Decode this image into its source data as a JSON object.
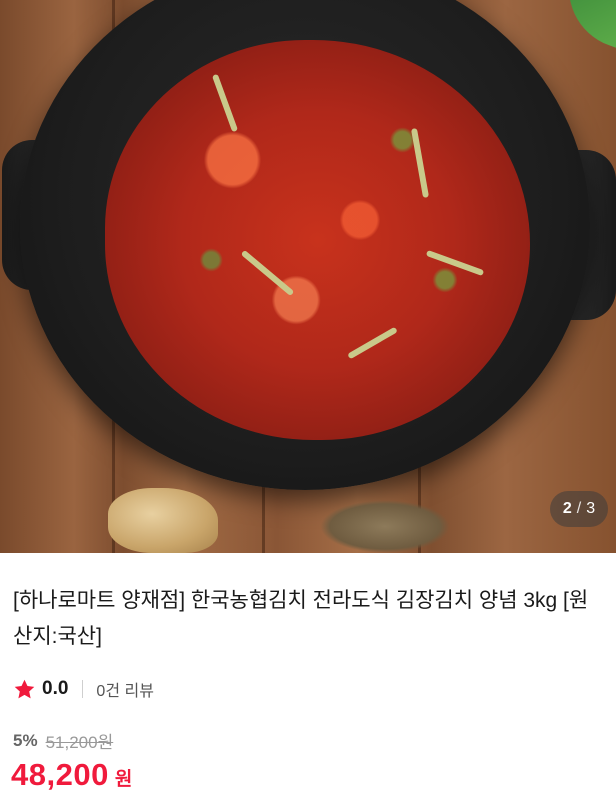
{
  "gallery": {
    "current": "2",
    "separator": "/",
    "total": "3"
  },
  "product": {
    "title": "[하나로마트 양재점] 한국농협김치 전라도식 김장김치 양념 3kg [원산지:국산]"
  },
  "rating": {
    "score": "0.0",
    "reviews": "0건 리뷰",
    "star_color": "#f01a3c"
  },
  "pricing": {
    "discount": "5%",
    "original_price": "51,200원",
    "price": "48,200",
    "currency": "원",
    "price_color": "#f01a3c"
  },
  "icons": {
    "rating": "star-icon"
  }
}
